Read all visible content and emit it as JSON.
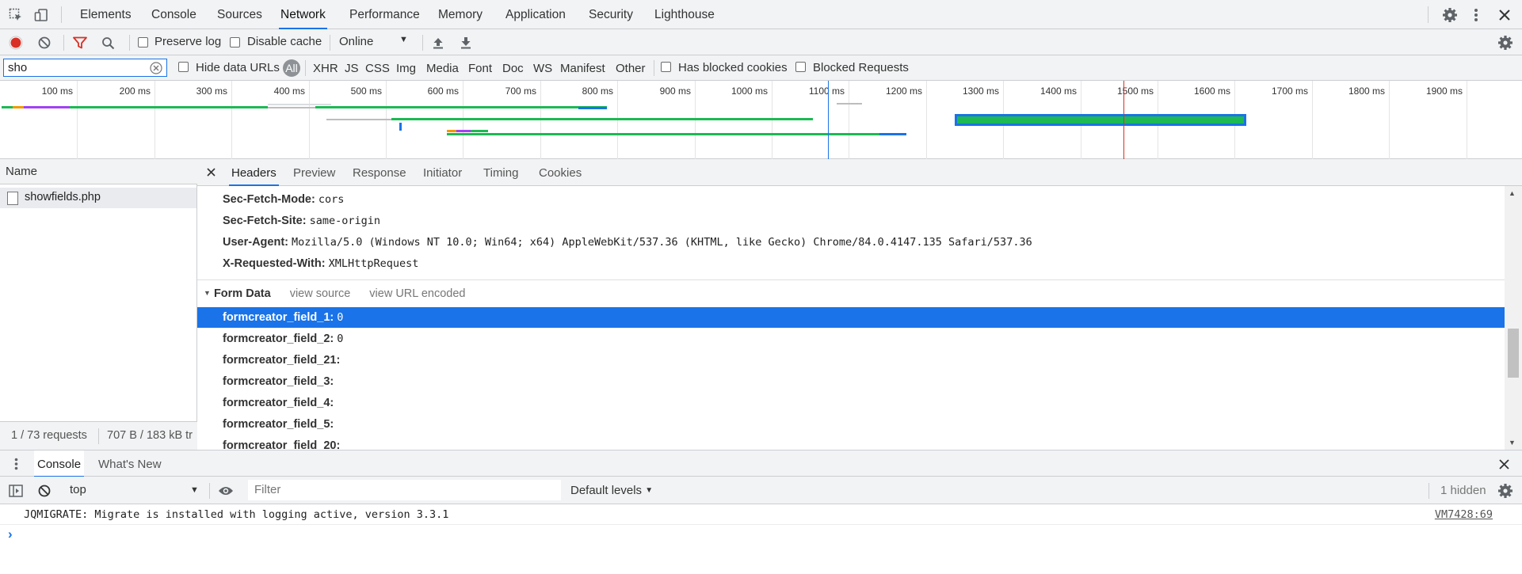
{
  "top_tabs": [
    "Elements",
    "Console",
    "Sources",
    "Network",
    "Performance",
    "Memory",
    "Application",
    "Security",
    "Lighthouse"
  ],
  "active_top_tab": "Network",
  "toolbar": {
    "preserve_log": "Preserve log",
    "disable_cache": "Disable cache",
    "throttling": "Online"
  },
  "filterbar": {
    "filter_value": "sho",
    "hide_data_urls": "Hide data URLs",
    "all": "All",
    "types": [
      "XHR",
      "JS",
      "CSS",
      "Img",
      "Media",
      "Font",
      "Doc",
      "WS",
      "Manifest",
      "Other"
    ],
    "has_blocked_cookies": "Has blocked cookies",
    "blocked_requests": "Blocked Requests"
  },
  "timeline": {
    "ticks": [
      "100 ms",
      "200 ms",
      "300 ms",
      "400 ms",
      "500 ms",
      "600 ms",
      "700 ms",
      "800 ms",
      "900 ms",
      "1000 ms",
      "1100 ms",
      "1200 ms",
      "1300 ms",
      "1400 ms",
      "1500 ms",
      "1600 ms",
      "1700 ms",
      "1800 ms",
      "1900 ms",
      "200"
    ],
    "dom_content_loaded_ms": 1100,
    "load_ms": 1490
  },
  "requests": {
    "column_name": "Name",
    "items": [
      "showfields.php"
    ],
    "summary_count": "1 / 73 requests",
    "summary_size": "707 B / 183 kB tr"
  },
  "detail_tabs": [
    "Headers",
    "Preview",
    "Response",
    "Initiator",
    "Timing",
    "Cookies"
  ],
  "active_detail_tab": "Headers",
  "headers": [
    {
      "key": "Sec-Fetch-Mode:",
      "value": "cors"
    },
    {
      "key": "Sec-Fetch-Site:",
      "value": "same-origin"
    },
    {
      "key": "User-Agent:",
      "value": "Mozilla/5.0 (Windows NT 10.0; Win64; x64) AppleWebKit/537.36 (KHTML, like Gecko) Chrome/84.0.4147.135 Safari/537.36"
    },
    {
      "key": "X-Requested-With:",
      "value": "XMLHttpRequest"
    }
  ],
  "form_data": {
    "title": "Form Data",
    "view_source": "view source",
    "view_url_encoded": "view URL encoded",
    "items": [
      {
        "key": "formcreator_field_1:",
        "value": "0"
      },
      {
        "key": "formcreator_field_2:",
        "value": "0"
      },
      {
        "key": "formcreator_field_21:",
        "value": ""
      },
      {
        "key": "formcreator_field_3:",
        "value": ""
      },
      {
        "key": "formcreator_field_4:",
        "value": ""
      },
      {
        "key": "formcreator_field_5:",
        "value": ""
      },
      {
        "key": "formcreator_field_20:",
        "value": ""
      }
    ]
  },
  "drawer": {
    "tabs": [
      "Console",
      "What's New"
    ],
    "context": "top",
    "filter_placeholder": "Filter",
    "levels": "Default levels",
    "hidden": "1 hidden",
    "message": "JQMIGRATE: Migrate is installed with logging active, version 3.3.1",
    "message_source": "VM7428:69",
    "prompt": "›"
  },
  "colors": {
    "accent": "#1a73e8",
    "record": "#d93025",
    "dom_line": "#1a73e8",
    "load_line": "#d93025"
  }
}
